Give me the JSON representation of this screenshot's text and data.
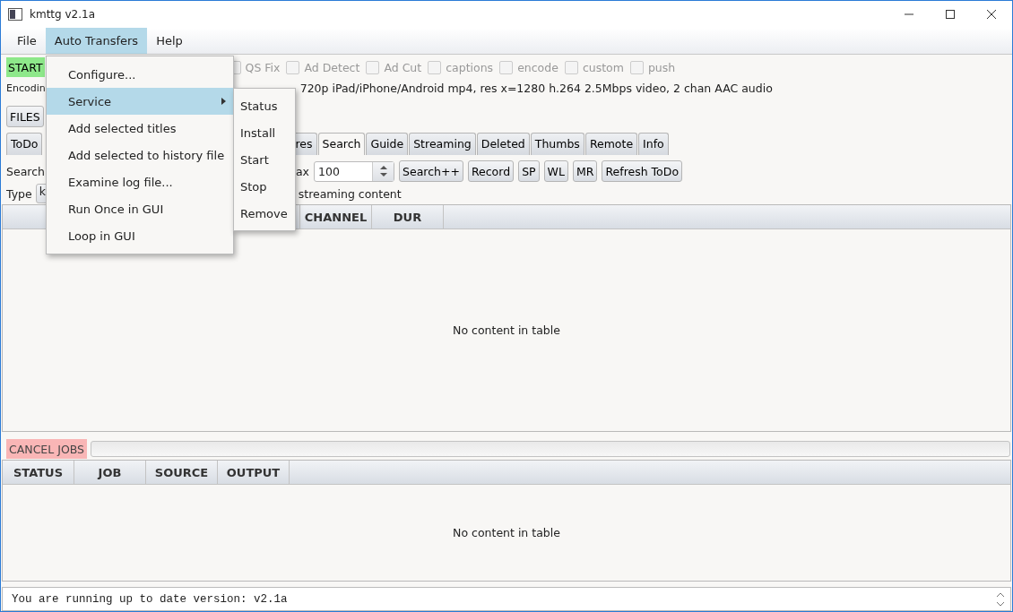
{
  "window": {
    "title": "kmttg v2.1a"
  },
  "menubar": [
    {
      "label": "File",
      "selected": false
    },
    {
      "label": "Auto Transfers",
      "selected": true
    },
    {
      "label": "Help",
      "selected": false
    }
  ],
  "open_menu": [
    {
      "label": "Configure...",
      "kind": "item",
      "selected": false
    },
    {
      "label": "Service",
      "kind": "submenu",
      "selected": true
    },
    {
      "label": "Add selected titles",
      "kind": "item",
      "selected": false
    },
    {
      "label": "Add selected to history file",
      "kind": "item",
      "selected": false
    },
    {
      "label": "Examine log file...",
      "kind": "item",
      "selected": false
    },
    {
      "label": "Run Once in GUI",
      "kind": "item",
      "selected": false
    },
    {
      "label": "Loop in GUI",
      "kind": "item",
      "selected": false
    }
  ],
  "submenu": [
    {
      "label": "Status"
    },
    {
      "label": "Install"
    },
    {
      "label": "Start"
    },
    {
      "label": "Stop"
    },
    {
      "label": "Remove"
    }
  ],
  "start_button": "START",
  "options": [
    {
      "label": "QS Fix",
      "checked": false
    },
    {
      "label": "Ad Detect",
      "checked": false
    },
    {
      "label": "Ad Cut",
      "checked": false
    },
    {
      "label": "captions",
      "checked": false
    },
    {
      "label": "encode",
      "checked": false
    },
    {
      "label": "custom",
      "checked": false
    },
    {
      "label": "push",
      "checked": false
    }
  ],
  "encoding": {
    "label": "Encodin",
    "value": "720p iPad/iPhone/Android mp4, res x=1280 h.264 2.5Mbps video, 2 chan AAC audio"
  },
  "files_button": "FILES",
  "first_tab": {
    "label": "ToDo",
    "selected": false
  },
  "tabs": [
    {
      "label": "res",
      "selected": false
    },
    {
      "label": "Search",
      "selected": true
    },
    {
      "label": "Guide",
      "selected": false
    },
    {
      "label": "Streaming",
      "selected": false
    },
    {
      "label": "Deleted",
      "selected": false
    },
    {
      "label": "Thumbs",
      "selected": false
    },
    {
      "label": "Remote",
      "selected": false
    },
    {
      "label": "Info",
      "selected": false
    }
  ],
  "search_row": {
    "label": "Search",
    "max_label": "ax",
    "max_value": "100",
    "buttons": [
      "Search++",
      "Record",
      "SP",
      "WL",
      "MR",
      "Refresh ToDo"
    ]
  },
  "type_row": {
    "label": "Type",
    "value": "k",
    "streaming_label": "streaming content"
  },
  "shows_table": {
    "columns": [
      "CHANNEL",
      "DUR"
    ],
    "empty": "No content in table"
  },
  "cancel_button": "CANCEL JOBS",
  "progress": {
    "level": 0
  },
  "jobs_table": {
    "columns": [
      "STATUS",
      "JOB",
      "SOURCE",
      "OUTPUT"
    ],
    "empty": "No content in table"
  },
  "log": "You are running up to date version: v2.1a"
}
